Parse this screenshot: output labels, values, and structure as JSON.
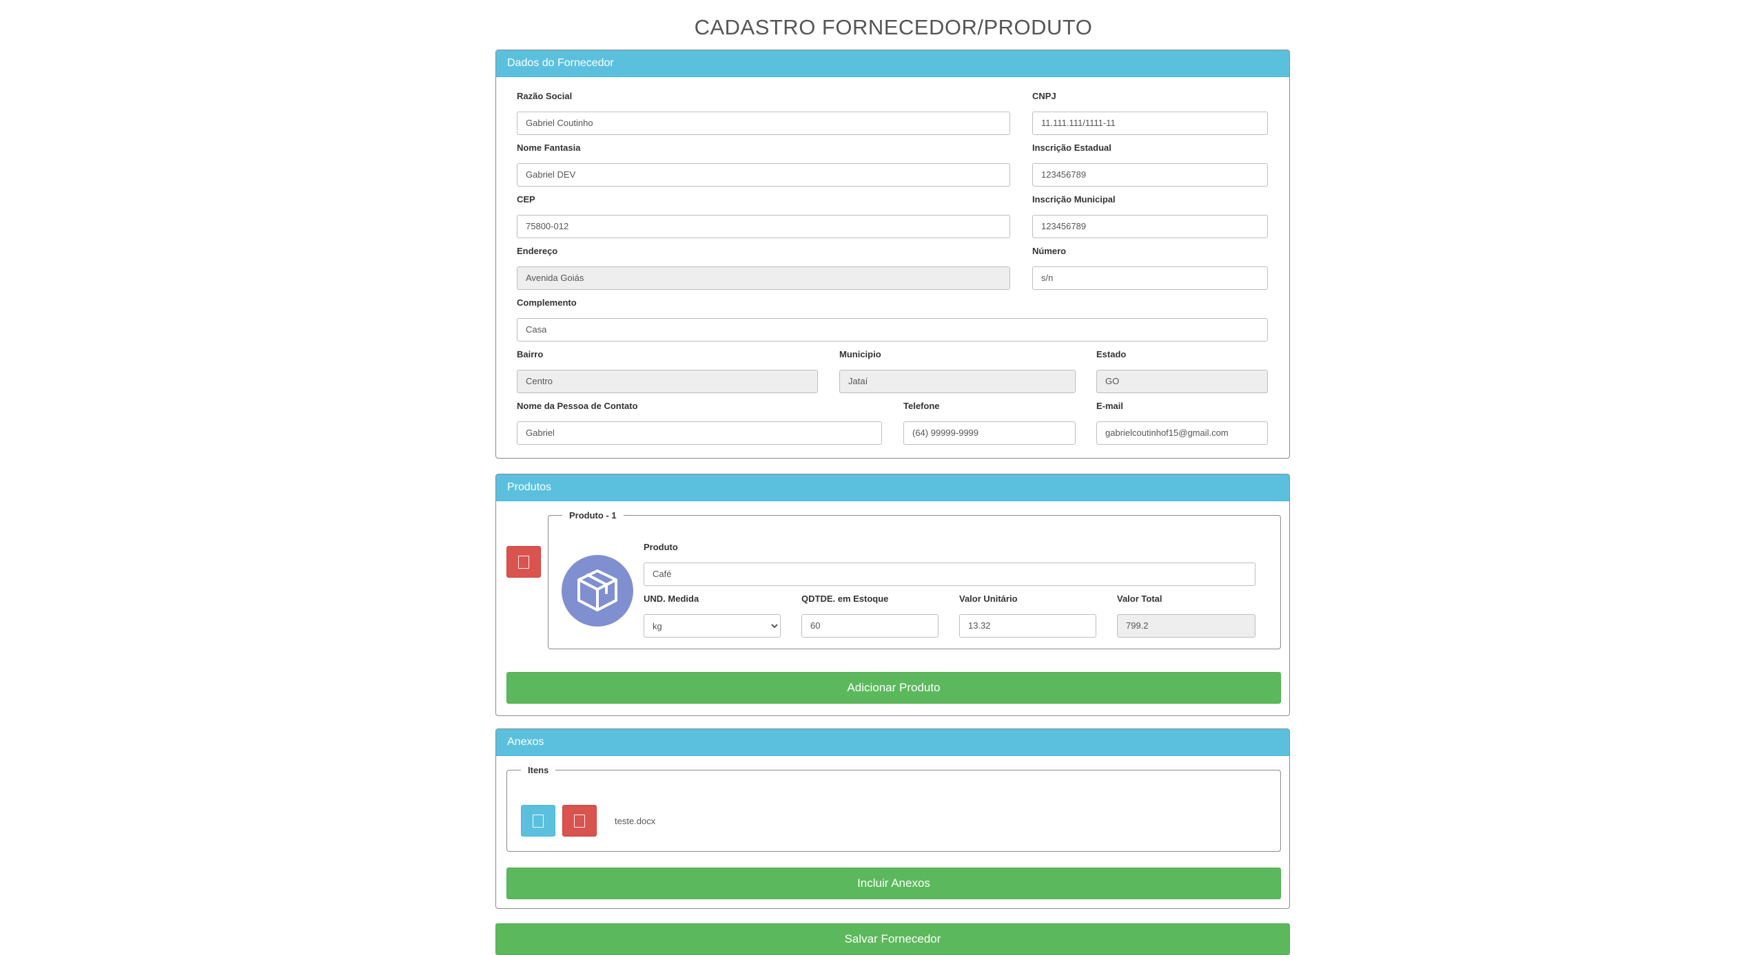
{
  "page": {
    "title": "CADASTRO FORNECEDOR/PRODUTO"
  },
  "supplier": {
    "heading": "Dados do Fornecedor",
    "razao_social": {
      "label": "Razão Social",
      "value": "Gabriel Coutinho"
    },
    "cnpj": {
      "label": "CNPJ",
      "value": "11.111.111/1111-11"
    },
    "nome_fantasia": {
      "label": "Nome Fantasia",
      "value": "Gabriel DEV"
    },
    "inscricao_estadual": {
      "label": "Inscrição Estadual",
      "value": "123456789"
    },
    "cep": {
      "label": "CEP",
      "value": "75800-012"
    },
    "inscricao_municipal": {
      "label": "Inscrição Municipal",
      "value": "123456789"
    },
    "endereco": {
      "label": "Endereço",
      "value": "Avenida Goiás"
    },
    "numero": {
      "label": "Número",
      "value": "s/n"
    },
    "complemento": {
      "label": "Complemento",
      "value": "Casa"
    },
    "bairro": {
      "label": "Bairro",
      "value": "Centro"
    },
    "municipio": {
      "label": "Municipio",
      "value": "Jataí"
    },
    "estado": {
      "label": "Estado",
      "value": "GO"
    },
    "contato": {
      "label": "Nome da Pessoa de Contato",
      "value": "Gabriel"
    },
    "telefone": {
      "label": "Telefone",
      "value": "(64) 99999-9999"
    },
    "email": {
      "label": "E-mail",
      "value": "gabrielcoutinhof15@gmail.com"
    }
  },
  "products": {
    "heading": "Produtos",
    "item_legend": "Produto - 1",
    "produto": {
      "label": "Produto",
      "value": "Café"
    },
    "unidade": {
      "label": "UND. Medida",
      "value": "kg"
    },
    "quantidade": {
      "label": "QDTDE. em Estoque",
      "value": "60"
    },
    "valor_unitario": {
      "label": "Valor Unitário",
      "value": "13.32"
    },
    "valor_total": {
      "label": "Valor Total",
      "value": "799.2"
    },
    "add_button": "Adicionar Produto",
    "icons": {
      "remove": "trash-icon",
      "product": "box-icon"
    }
  },
  "attachments": {
    "heading": "Anexos",
    "items_legend": "Itens",
    "file_name": "teste.docx",
    "add_button": "Incluir Anexos",
    "icons": {
      "view": "eye-icon",
      "remove": "trash-icon"
    }
  },
  "save_button": "Salvar Fornecedor",
  "colors": {
    "panel_heading": "#5bc0de",
    "success": "#5cb85c",
    "danger": "#d9534f",
    "info": "#5bc0de",
    "product_avatar": "#7f8fd0"
  }
}
